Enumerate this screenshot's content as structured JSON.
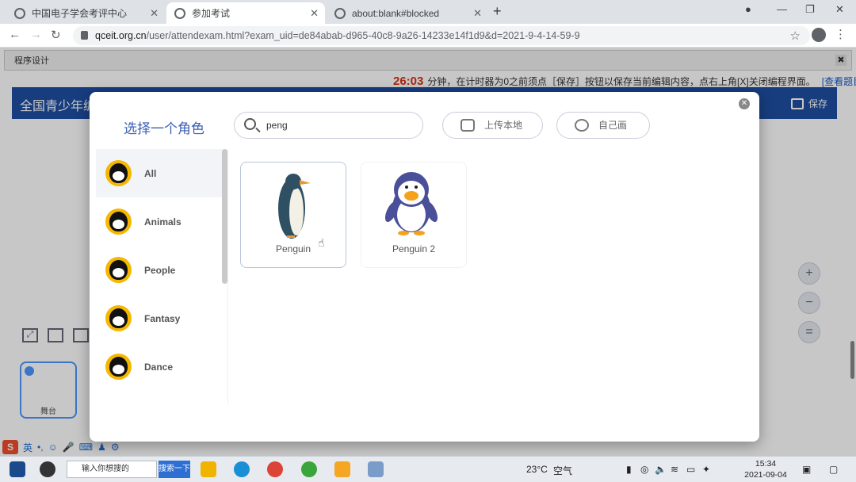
{
  "browser": {
    "tabs": [
      {
        "title": "中国电子学会考评中心",
        "active": false
      },
      {
        "title": "参加考试",
        "active": true
      },
      {
        "title": "about:blank#blocked",
        "active": false
      }
    ],
    "url_host": "qceit.org.cn",
    "url_path": "/user/attendexam.html?exam_uid=de84abab-d965-40c8-9a26-14233e14f1d9&d=2021-9-4-14-59-9"
  },
  "dialog": {
    "title": "程序设计",
    "close": "✖"
  },
  "exam": {
    "timer": "26:03",
    "notice": "分钟，在计时器为0之前须点［保存］按钮以保存当前编辑内容，点右上角[X]关闭编程界面。",
    "view_question": "[查看题目]"
  },
  "scratch": {
    "header_title": "全国青少年编",
    "save_label": "保存",
    "stage_label": "舞台"
  },
  "modal": {
    "title": "选择一个角色",
    "search_value": "peng",
    "upload_label": "上传本地",
    "paint_label": "自己画",
    "categories": [
      "All",
      "Animals",
      "People",
      "Fantasy",
      "Dance"
    ],
    "sprites": [
      "Penguin",
      "Penguin 2"
    ]
  },
  "ime": {
    "logo": "S",
    "mode": "英"
  },
  "taskbar": {
    "search_placeholder": "输入你想搜的",
    "search_button": "搜索一下",
    "temperature": "23°C",
    "weather": "空气",
    "time": "15:34",
    "date": "2021-09-04"
  }
}
